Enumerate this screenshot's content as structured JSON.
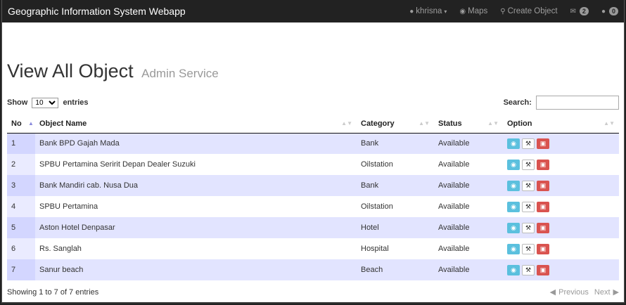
{
  "navbar": {
    "brand": "Geographic Information System Webapp",
    "user": "khrisna",
    "maps": "Maps",
    "create": "Create Object",
    "messages_count": "2",
    "users_count": "0"
  },
  "page": {
    "title": "View All Object",
    "subtitle": "Admin Service"
  },
  "controls": {
    "show_label": "Show",
    "entries_value": "10",
    "entries_label": "entries",
    "search_label": "Search:"
  },
  "table": {
    "headers": [
      "No",
      "Object Name",
      "Category",
      "Status",
      "Option"
    ],
    "rows": [
      {
        "no": "1",
        "name": "Bank BPD Gajah Mada",
        "category": "Bank",
        "status": "Available"
      },
      {
        "no": "2",
        "name": "SPBU Pertamina Seririt Depan Dealer Suzuki",
        "category": "Oilstation",
        "status": "Available"
      },
      {
        "no": "3",
        "name": "Bank Mandiri cab. Nusa Dua",
        "category": "Bank",
        "status": "Available"
      },
      {
        "no": "4",
        "name": "SPBU Pertamina",
        "category": "Oilstation",
        "status": "Available"
      },
      {
        "no": "5",
        "name": "Aston Hotel Denpasar",
        "category": "Hotel",
        "status": "Available"
      },
      {
        "no": "6",
        "name": "Rs. Sanglah",
        "category": "Hospital",
        "status": "Available"
      },
      {
        "no": "7",
        "name": "Sanur beach",
        "category": "Beach",
        "status": "Available"
      }
    ]
  },
  "footer": {
    "info": "Showing 1 to 7 of 7 entries",
    "previous": "Previous",
    "next": "Next"
  }
}
